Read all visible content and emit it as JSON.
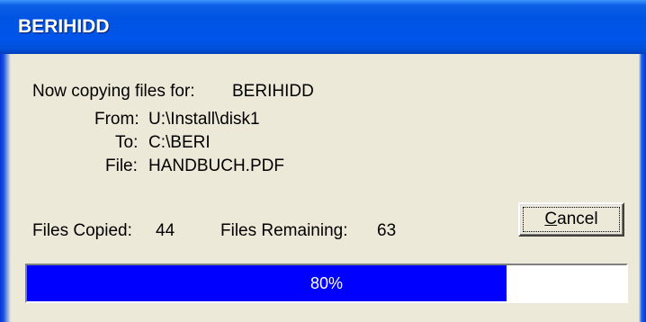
{
  "window": {
    "title": "BERIHIDD"
  },
  "copy": {
    "prefix": "Now copying files for:",
    "product": "BERIHIDD",
    "from_label": "From:",
    "from_value": "U:\\Install\\disk1",
    "to_label": "To:",
    "to_value": "C:\\BERI",
    "file_label": "File:",
    "file_value": "HANDBUCH.PDF"
  },
  "stats": {
    "copied_label": "Files Copied:",
    "copied_value": "44",
    "remaining_label": "Files Remaining:",
    "remaining_value": "63"
  },
  "buttons": {
    "cancel_label": "Cancel",
    "cancel_mnemonic": "C",
    "cancel_rest": "ancel"
  },
  "progress": {
    "percent": 80,
    "label": "80%",
    "fill_color": "#0000ff"
  },
  "colors": {
    "dialog_bg": "#ece9d8",
    "title_blue": "#0054e3"
  }
}
